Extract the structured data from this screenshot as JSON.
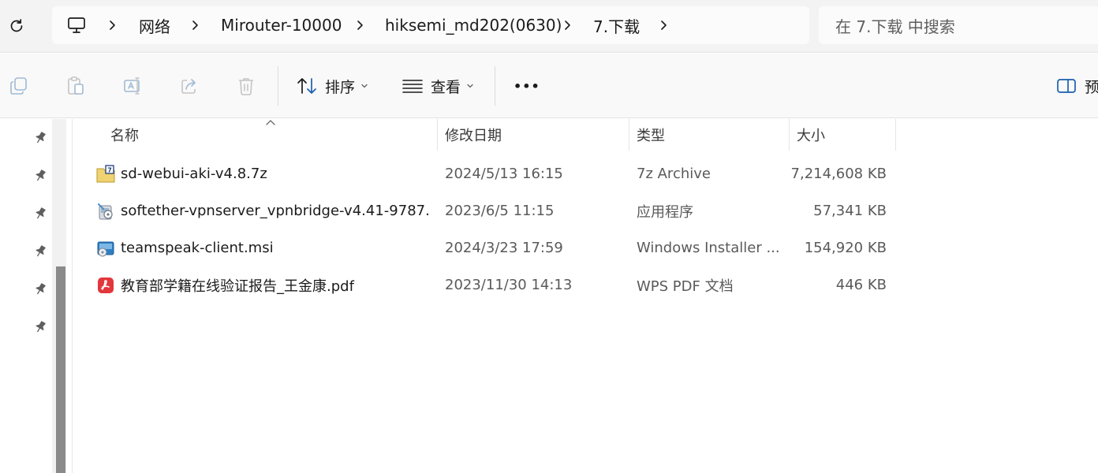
{
  "breadcrumb": {
    "items": [
      {
        "label": "网络"
      },
      {
        "label": "Mirouter-10000"
      },
      {
        "label": "hiksemi_md202(0630)"
      },
      {
        "label": "7.下载"
      }
    ]
  },
  "search": {
    "placeholder": "在 7.下载 中搜索"
  },
  "toolbar": {
    "sort_label": "排序",
    "view_label": "查看",
    "more_label": "•••",
    "preview_label": "预"
  },
  "columns": {
    "name": "名称",
    "modified": "修改日期",
    "type": "类型",
    "size": "大小"
  },
  "files": [
    {
      "name": "sd-webui-aki-v4.8.7z",
      "modified": "2024/5/13 16:15",
      "type": "7z Archive",
      "size": "7,214,608 KB",
      "icon": "archive-7z-icon"
    },
    {
      "name": "softether-vpnserver_vpnbridge-v4.41-9787...",
      "modified": "2023/6/5 11:15",
      "type": "应用程序",
      "size": "57,341 KB",
      "icon": "setup-exe-icon"
    },
    {
      "name": "teamspeak-client.msi",
      "modified": "2024/3/23 17:59",
      "type": "Windows Installer ...",
      "size": "154,920 KB",
      "icon": "msi-installer-icon"
    },
    {
      "name": "教育部学籍在线验证报告_王金康.pdf",
      "modified": "2023/11/30 14:13",
      "type": "WPS PDF 文档",
      "size": "446 KB",
      "icon": "pdf-icon"
    }
  ],
  "colors": {
    "accent": "#0067c0",
    "pdf": "#e2373c"
  }
}
